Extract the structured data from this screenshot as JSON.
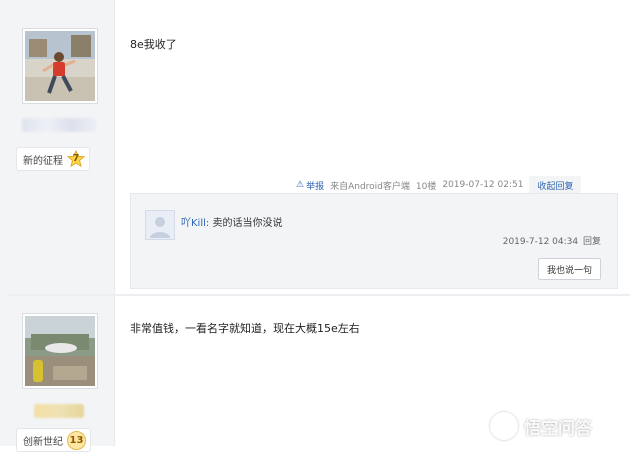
{
  "posts": [
    {
      "badge_label": "新的征程",
      "badge_level": "7",
      "content": "8e我收了",
      "meta": {
        "report_label": "举报",
        "source": "来自Android客户端",
        "floor": "10楼",
        "time": "2019-07-12 02:51",
        "reply_toggle": "收起回复"
      },
      "replies": [
        {
          "user": "吖Kill:",
          "content": "卖的话当你没说",
          "time": "2019-7-12 04:34",
          "reply_link": "回复"
        }
      ],
      "say_button": "我也说一句"
    },
    {
      "badge_label": "创新世纪",
      "badge_level": "13",
      "content": "非常值钱，一看名字就知道，现在大概15e左右"
    }
  ],
  "watermark": {
    "text": "悟空问答",
    "icon": "wukong-logo-icon"
  },
  "colors": {
    "link": "#2d64b3",
    "sidebar": "#f3f4f6",
    "level_badge": "#ffe7a3"
  }
}
